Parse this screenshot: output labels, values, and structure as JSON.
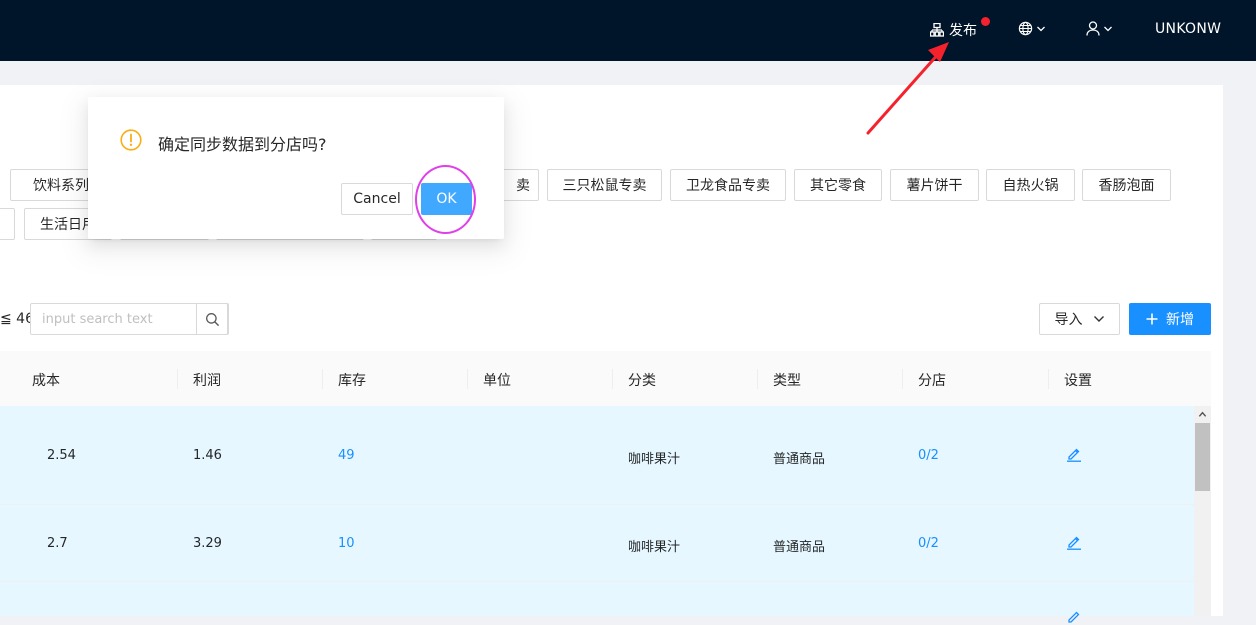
{
  "header": {
    "publish_label": "发布",
    "username": "UNKONW",
    "icons": [
      "publish-icon",
      "globe-icon",
      "user-icon",
      "chevron-down-icon"
    ]
  },
  "category_tags": {
    "row1": [
      "饮料系列",
      "卖",
      "三只松鼠专卖",
      "卫龙食品专卖",
      "其它零食",
      "薯片饼干",
      "自热火锅",
      "香肠泡面"
    ],
    "row2": [
      "生活日用"
    ]
  },
  "search": {
    "total_prefix": "≦ 46",
    "placeholder": "input search text"
  },
  "actions": {
    "import_label": "导入",
    "add_label": "新增"
  },
  "table": {
    "columns": [
      "成本",
      "利润",
      "库存",
      "单位",
      "分类",
      "类型",
      "分店",
      "设置"
    ],
    "rows": [
      {
        "cost": "2.54",
        "profit": "1.46",
        "stock": "49",
        "unit": "",
        "category": "咖啡果汁",
        "type": "普通商品",
        "branch": "0/2"
      },
      {
        "cost": "2.7",
        "profit": "3.29",
        "stock": "10",
        "unit": "",
        "category": "咖啡果汁",
        "type": "普通商品",
        "branch": "0/2"
      }
    ]
  },
  "modal": {
    "title": "确定同步数据到分店吗?",
    "cancel_label": "Cancel",
    "ok_label": "OK"
  },
  "colors": {
    "navbar": "#001529",
    "primary": "#1890ff",
    "ok_button": "#40a9ff",
    "badge": "#f5222d",
    "warning_icon": "#faad14",
    "row_highlight": "#e6f7ff",
    "annotation_circle": "#e040e8",
    "annotation_arrow": "#f5222d"
  }
}
